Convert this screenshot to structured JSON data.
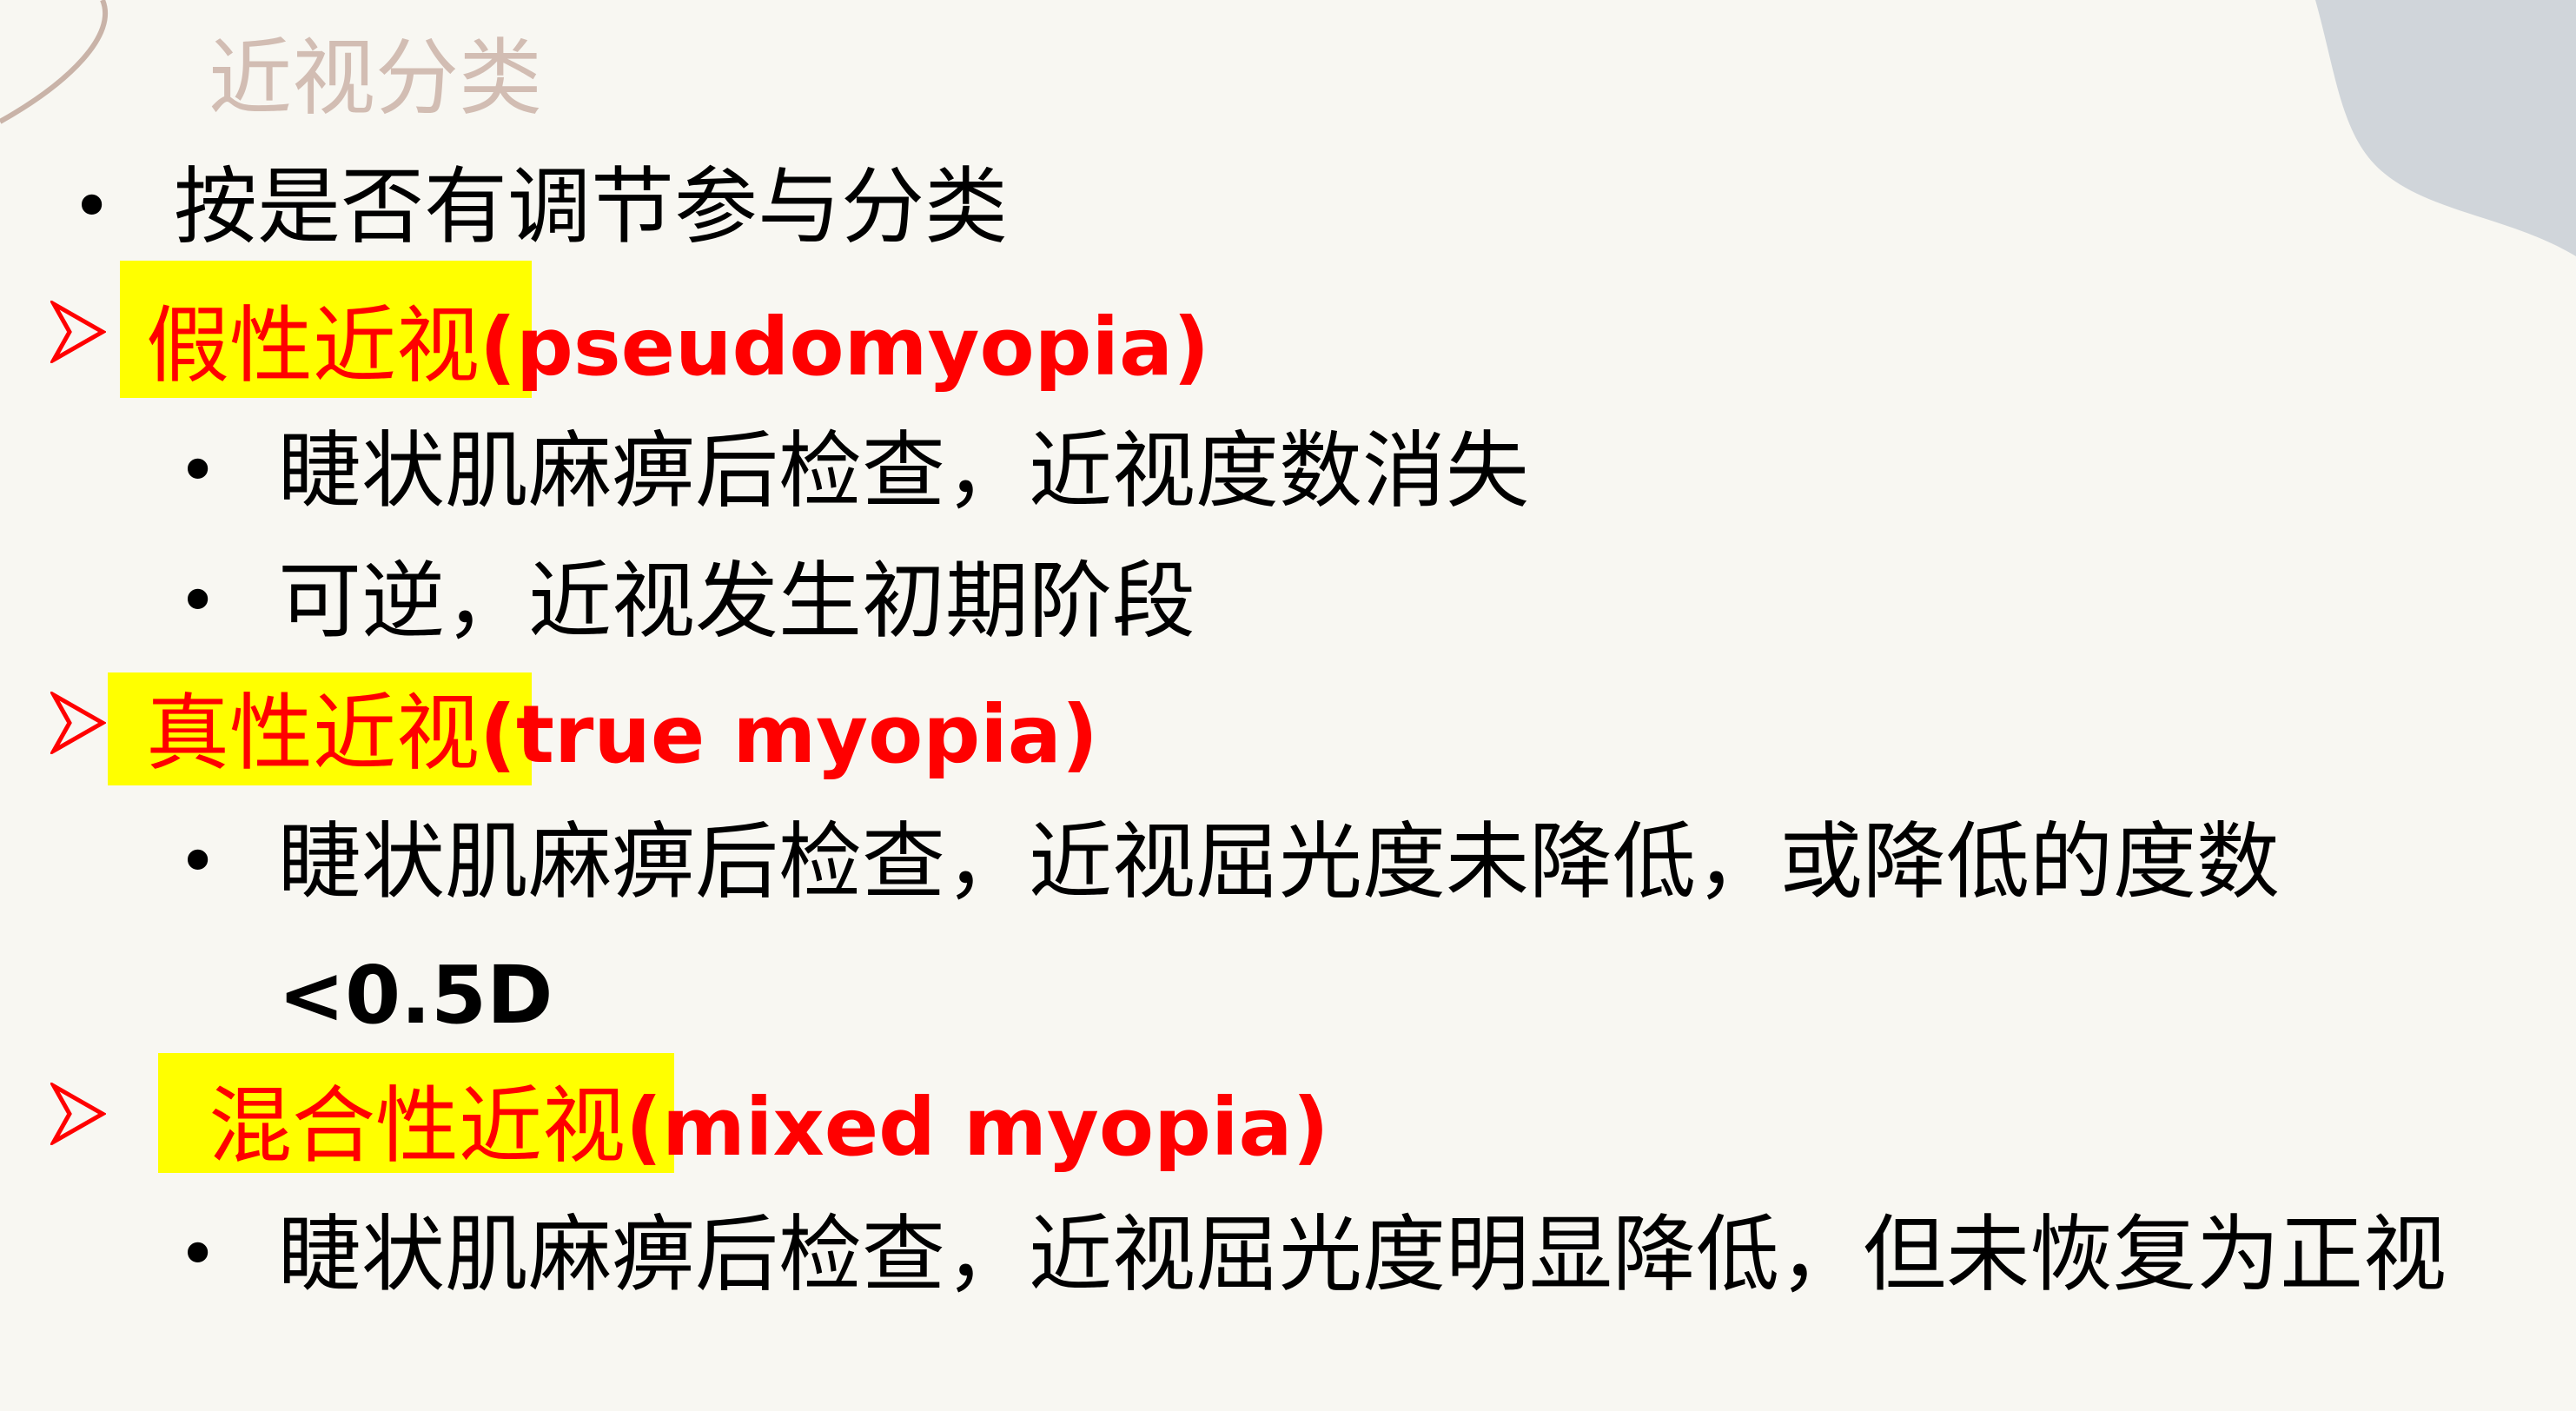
{
  "colors": {
    "background": "#f8f7f2",
    "title": "#d2bdb3",
    "accent_red": "#ff0000",
    "highlight": "#ffff00",
    "corner_shape": "#d0d5da",
    "corner_curve": "#c9b3a8"
  },
  "slide": {
    "title": "近视分类",
    "intro": "按是否有调节参与分类",
    "sections": [
      {
        "head_cn": "假性近视",
        "head_en": "(pseudomyopia)",
        "bullets": [
          "睫状肌麻痹后检查，近视度数消失",
          "可逆，近视发生初期阶段"
        ]
      },
      {
        "head_cn": "真性近视",
        "head_en": "(true myopia)",
        "bullets": [
          "睫状肌麻痹后检查，近视屈光度未降低，或降低的度数"
        ],
        "bullet_continuation": "<0.5D"
      },
      {
        "head_cn": "混合性近视",
        "head_en": "(mixed myopia)",
        "bullets": [
          "睫状肌麻痹后检查，近视屈光度明显降低，但未恢复为正视"
        ]
      }
    ],
    "bullet_glyph": "•",
    "arrow_icon": "arrow-bullet-icon"
  }
}
